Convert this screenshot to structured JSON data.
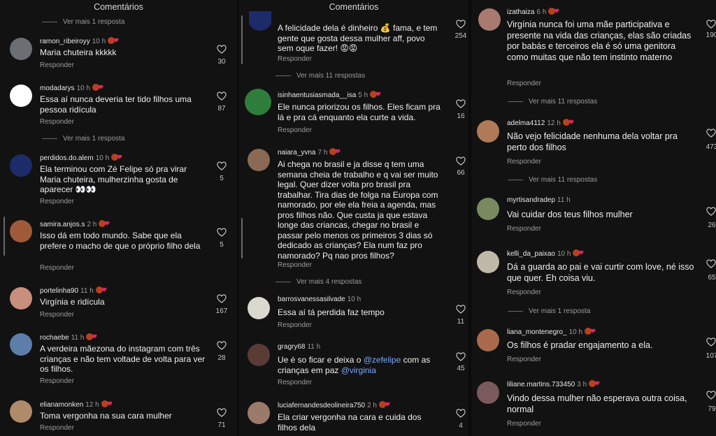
{
  "header": {
    "title": "Comentários"
  },
  "labels": {
    "reply": "Responder"
  },
  "columns": [
    {
      "title": "Comentários",
      "items": [
        {
          "type": "more",
          "label": "Ver mais 1 resposta"
        },
        {
          "type": "comment",
          "username": "ramon_ribeiroyy",
          "time": "10 h",
          "text": "Maria chuteira kkkkk",
          "likes": "30",
          "avatar_color": "#6b6f73"
        },
        {
          "type": "comment",
          "username": "modadarys",
          "time": "10 h",
          "text": "Essa aí nunca deveria ter tido filhos uma pessoa ridícula",
          "likes": "87",
          "avatar_color": "#ffffff"
        },
        {
          "type": "more",
          "label": "Ver mais 1 resposta"
        },
        {
          "type": "comment",
          "username": "perdidos.do.alem",
          "time": "10 h",
          "text": "Ela terminou com Zé Felipe só pra virar Maria chuteira, mulherzinha gosta de aparecer 👀👀",
          "likes": "5",
          "avatar_color": "#1d2b6b"
        },
        {
          "type": "comment",
          "username": "samira.anjos.s",
          "time": "2 h",
          "text": "Isso dá em todo mundo. Sabe que ela prefere o macho de que o próprio filho dela",
          "likes": "5",
          "avatar_color": "#a05a3a"
        },
        {
          "type": "comment",
          "username": "portelinha90",
          "time": "11 h",
          "text": "Virgínia e ridícula",
          "likes": "167",
          "avatar_color": "#c98f7c"
        },
        {
          "type": "comment",
          "username": "rochaebe",
          "time": "11 h",
          "text": "A verdeira mãezona do instagram com três crianças e não tem voltade de volta para ver os filhos.",
          "likes": "28",
          "avatar_color": "#5d7ea8"
        },
        {
          "type": "comment",
          "username": "elianamonken",
          "time": "12 h",
          "text": "Toma vergonha na sua cara mulher",
          "likes": "71",
          "avatar_color": "#b08a6a"
        }
      ]
    },
    {
      "title": "Comentários",
      "items": [
        {
          "type": "comment",
          "username": "",
          "time": "",
          "text": "A felicidade dela é dinheiro 💰 fama, e tem gente que gosta dessa mulher aff, povo sem oque fazer! 😡😡",
          "likes": "254",
          "avatar_color": "#1d2b6b"
        },
        {
          "type": "more",
          "label": "Ver mais 11 respostas"
        },
        {
          "type": "comment",
          "username": "isinhaentusiasmada__isa",
          "time": "5 h",
          "text": "Ele nunca priorizou os filhos.  Eles ficam pra lá e pra cá enquanto ela curte a vida.",
          "likes": "16",
          "avatar_color": "#2f7d3a"
        },
        {
          "type": "comment",
          "username": "naiara_yvna",
          "time": "7 h",
          "text": "Ai chega no brasil e ja disse q tem uma semana cheia de trabalho e q vai ser muito legal. Quer dizer volta pro brasil pra trabalhar. Tira dias de folga na Europa com namorado, por ele ela freia a agenda, mas pros filhos não. Que custa ja que estava longe das criancas, chegar no brasil e passar pelo menos os primeiros 3 dias só dedicado as crianças? Ela num faz pro namorado? Pq nao pros filhos?",
          "likes": "66",
          "avatar_color": "#8a6a55"
        },
        {
          "type": "more",
          "label": "Ver mais 4 respostas"
        },
        {
          "type": "comment",
          "username": "barrosvanessasilvade",
          "time": "10 h",
          "text": "Essa aí tá perdida faz tempo",
          "likes": "11",
          "avatar_color": "#d9d9d0"
        },
        {
          "type": "comment",
          "username": "gragry68",
          "time": "11 h",
          "text_before": "Ue é so ficar e deixa o ",
          "mention1": "@zefelipe",
          "text_mid": " com as crianças em paz ",
          "mention2": "@virginia",
          "likes": "45",
          "avatar_color": "#5a3b35"
        },
        {
          "type": "comment",
          "username": "luciafernandesdeolineira750",
          "time": "2 h",
          "text": "Ela criar vergonha na cara e cuida dos filhos dela",
          "likes": "4",
          "avatar_color": "#9b7a6a"
        }
      ]
    },
    {
      "title": "",
      "items": [
        {
          "type": "comment",
          "username": "izathaiza",
          "time": "6 h",
          "text": "Virgínia nunca foi uma mãe participativa e presente na vida das crianças, elas são criadas por babás e terceiros ela é só uma genitora como muitas que não tem instinto materno",
          "likes": "190",
          "avatar_color": "#a87a70"
        },
        {
          "type": "more",
          "label": "Ver mais 11 respostas"
        },
        {
          "type": "comment",
          "username": "adelma4112",
          "time": "12 h",
          "text": "Não vejo felicidade nenhuma dela voltar pra perto dos filhos",
          "likes": "473",
          "avatar_color": "#b07a58"
        },
        {
          "type": "more",
          "label": "Ver mais 11 respostas"
        },
        {
          "type": "comment",
          "username": "myrtisandradep",
          "time": "11 h",
          "text": "Vai cuidar dos teus filhos mulher",
          "likes": "26",
          "avatar_color": "#7a8a60"
        },
        {
          "type": "comment",
          "username": "kelli_da_paixao",
          "time": "10 h",
          "text": "Dá a guarda ao pai e vai curtir com love, né isso que quer. Eh coisa viu.",
          "likes": "65",
          "avatar_color": "#c0b8a8"
        },
        {
          "type": "more",
          "label": "Ver mais 1 resposta"
        },
        {
          "type": "comment",
          "username": "liana_montenegro_",
          "time": "10 h",
          "text": "Os filhos é pradar engajamento a ela.",
          "likes": "107",
          "avatar_color": "#a86a4a"
        },
        {
          "type": "comment",
          "username": "liliane.martins.733450",
          "time": "3 h",
          "text": "Vindo dessa mulher não esperava outra coisa,  normal",
          "likes": "79",
          "avatar_color": "#7a5a5a"
        }
      ]
    }
  ]
}
